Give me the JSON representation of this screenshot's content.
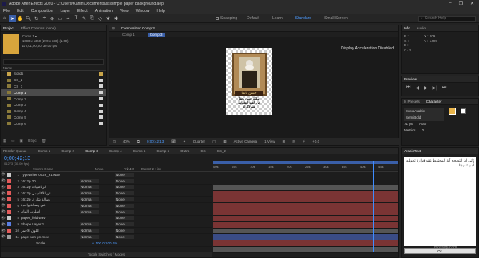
{
  "window": {
    "title": "Adobe After Effects 2020 - C:\\Users\\Karim\\Documents\\ss\\simple paper background.aep",
    "controls": [
      "–",
      "❐",
      "✕"
    ]
  },
  "menu": [
    "File",
    "Edit",
    "Composition",
    "Layer",
    "Effect",
    "Animation",
    "View",
    "Window",
    "Help"
  ],
  "toolbar": {
    "snapping": "Snapping",
    "workspaces": [
      "Default",
      "Learn",
      "Standard",
      "Small Screen"
    ],
    "active_workspace": "Standard",
    "search_placeholder": "Search Help"
  },
  "project": {
    "tab": "Project",
    "effect_tab": "Effect Controls (none)",
    "comp_name": "Comp 1 ▾",
    "comp_info1": "1080 x 1350 (270 x 338) (1.00)",
    "comp_info2": "Δ 0;01;00;00, 30.00 fps",
    "items": [
      "Solids",
      "CS_2",
      "CS_1",
      "Comp 1",
      "Comp 2",
      "Comp 3",
      "Comp 4",
      "Comp 5",
      "Comp 6"
    ],
    "selected": "Comp 1",
    "bpc": "8 bpc"
  },
  "composition": {
    "tab": "Composition Comp 3",
    "sub_tabs": [
      "Comp 1",
      "Comp 3"
    ],
    "notice": "Display Acceleration Disabled",
    "footer": {
      "zoom": "40%",
      "timecode": "0;00;42;13",
      "resolution": "Quarter",
      "camera": "Active Camera",
      "view": "1 View",
      "exposure": "+0.0"
    }
  },
  "poster": {
    "title": "حسن بانقا",
    "line1": "ملكة حسن بانقا",
    "line2": "في العهد العثماني",
    "line3": "نعم لإكرام"
  },
  "info": {
    "tab": "Info",
    "audio": "Audio",
    "r": "R :",
    "g": "G :",
    "b": "B :",
    "a": "A : 0",
    "x": "X : 209",
    "y": "Y : 1499"
  },
  "preview": {
    "tab": "Preview"
  },
  "character": {
    "tabs": [
      "ls Presets",
      "Character"
    ],
    "font": "Expo Arabic",
    "style": "SemiBold",
    "size": "71 px",
    "leading": "Auto",
    "metrics": "Metrics",
    "tracking": "0"
  },
  "arabictext": {
    "tab": "ArabicText",
    "content": "تأتي أن التصحح آية المحتفط عقد قرارة تحويله أمم تنفيذنا",
    "ok": "Ok"
  },
  "timeline": {
    "render_queue": "Render Queue",
    "tabs": [
      "Comp 1",
      "Comp 2",
      "Comp 3",
      "Comp 4",
      "Comp 5",
      "Comp 6",
      "Outro",
      "CS",
      "CS_2"
    ],
    "active_tab": "Comp 3",
    "timecode": "0;00;42;13",
    "frames": "01273 (30.00 fps)",
    "col_source": "Source Name",
    "col_mode": "Mode",
    "col_trkmat": "TrkMat",
    "col_parent": "Parent & Link",
    "footer": "Toggle Switches / Modes",
    "ruler": [
      "00s",
      "05s",
      "10s",
      "15s",
      "20s",
      "25s",
      "30s",
      "35s",
      "40s",
      "45s"
    ],
    "layers": [
      {
        "num": "1",
        "name": "Typewriter-0026_91.wav",
        "mode": "",
        "parent": "None",
        "color": "#c9c9c9"
      },
      {
        "num": "2",
        "name": "1612p 20",
        "mode": "Norma",
        "parent": "None",
        "color": "#e35a5a"
      },
      {
        "num": "3",
        "name": "1612p الرياضيات",
        "mode": "Norma",
        "parent": "None",
        "color": "#e35a5a"
      },
      {
        "num": "4",
        "name": "1612p عن الأكاديمي",
        "mode": "Norma",
        "parent": "None",
        "color": "#e35a5a"
      },
      {
        "num": "5",
        "name": "1612p رسالة شارك",
        "mode": "Norma",
        "parent": "None",
        "color": "#e35a5a"
      },
      {
        "num": "6",
        "name": "عن رسالة واحدة",
        "mode": "Norma",
        "parent": "None",
        "color": "#e35a5a"
      },
      {
        "num": "7",
        "name": "أسلوب البيان",
        "mode": "Norma",
        "parent": "None",
        "color": "#e35a5a"
      },
      {
        "num": "8",
        "name": "paper_fold.wav",
        "mode": "",
        "parent": "None",
        "color": "#c9c9c9"
      },
      {
        "num": "9",
        "name": "Shape Layer 1",
        "mode": "Norma",
        "parent": "None",
        "color": "#5a7ee3"
      },
      {
        "num": "10",
        "name": "اللون الأحمر",
        "mode": "Norma",
        "parent": "None",
        "color": "#e35a5a"
      },
      {
        "num": "11",
        "name": "page turn pn.mov",
        "mode": "Norma",
        "parent": "None",
        "color": "#9f9f9f"
      }
    ],
    "scale_label": "Scale",
    "scale_val": "∞ 100.0,100.0%"
  },
  "watermark": {
    "name": "مستقل",
    "url": "mostaql.com"
  }
}
